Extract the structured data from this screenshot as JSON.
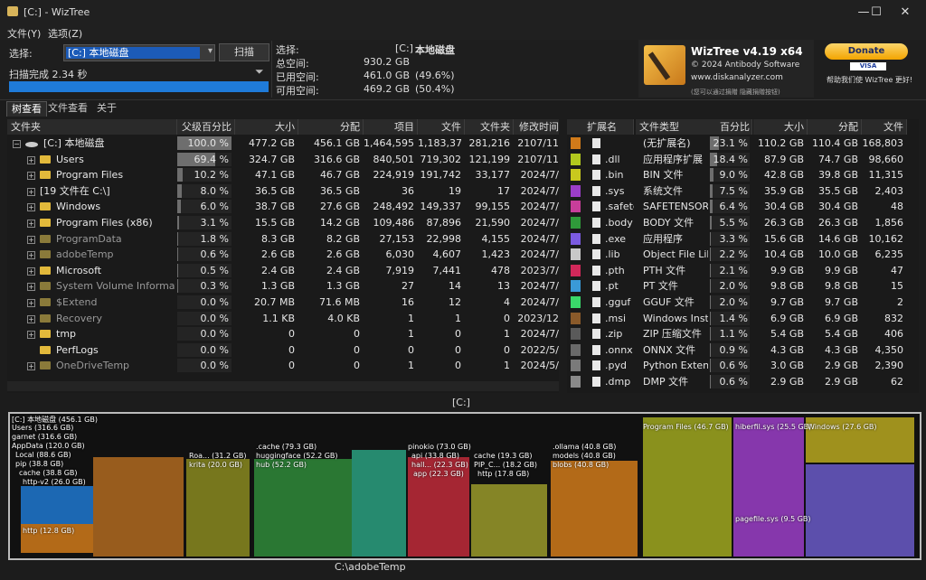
{
  "window": {
    "title": "[C:]  - WizTree"
  },
  "menu": [
    "文件(Y)",
    "选项(Z)"
  ],
  "select": {
    "label": "选择:",
    "drive": "[C:] 本地磁盘",
    "scan_button": "扫描"
  },
  "scan_status": "扫描完成 2.34 秒",
  "drive_info": {
    "select_label": "选择:",
    "drive": "[C:]",
    "drive_name": "本地磁盘",
    "rows": [
      {
        "label": "总空间:",
        "value": "930.2 GB",
        "pct": ""
      },
      {
        "label": "已用空间:",
        "value": "461.0 GB",
        "pct": "(49.6%)"
      },
      {
        "label": "可用空间:",
        "value": "469.2 GB",
        "pct": "(50.4%)"
      }
    ]
  },
  "about": {
    "title": "WizTree v4.19 x64",
    "copyright": "© 2024 Antibody Software",
    "site": "www.diskanalyzer.com",
    "note": "(您可以通过捐赠 隐藏捐赠按钮)"
  },
  "donate": {
    "button": "Donate",
    "cards": "VISA",
    "text": "帮助我们使 WizTree 更好!"
  },
  "tabs": [
    "树查看",
    "文件查看",
    "关于"
  ],
  "tree_columns": [
    "文件夹",
    "父级百分比",
    "大小",
    "分配",
    "项目",
    "文件",
    "文件夹",
    "修改时间"
  ],
  "tree_rows": [
    {
      "name": "[C:] 本地磁盘",
      "pct": "100.0 %",
      "pctv": 100,
      "size": "477.2 GB",
      "alloc": "456.1 GB",
      "items": "1,464,595",
      "files": "1,183,379",
      "folders": "281,216",
      "mtime": "2107/11",
      "indent": 0,
      "expander": "−",
      "icon": "drive"
    },
    {
      "name": "Users",
      "pct": "69.4 %",
      "pctv": 69.4,
      "size": "324.7 GB",
      "alloc": "316.6 GB",
      "items": "840,501",
      "files": "719,302",
      "folders": "121,199",
      "mtime": "2107/11",
      "indent": 1,
      "expander": "+",
      "icon": "folder"
    },
    {
      "name": "Program Files",
      "pct": "10.2 %",
      "pctv": 10.2,
      "size": "47.1 GB",
      "alloc": "46.7 GB",
      "items": "224,919",
      "files": "191,742",
      "folders": "33,177",
      "mtime": "2024/7/",
      "indent": 1,
      "expander": "+",
      "icon": "folder"
    },
    {
      "name": "[19 文件在 C:\\]",
      "pct": "8.0 %",
      "pctv": 8,
      "size": "36.5 GB",
      "alloc": "36.5 GB",
      "items": "36",
      "files": "19",
      "folders": "17",
      "mtime": "2024/7/",
      "indent": 1,
      "expander": "+",
      "icon": "none"
    },
    {
      "name": "Windows",
      "pct": "6.0 %",
      "pctv": 6,
      "size": "38.7 GB",
      "alloc": "27.6 GB",
      "items": "248,492",
      "files": "149,337",
      "folders": "99,155",
      "mtime": "2024/7/",
      "indent": 1,
      "expander": "+",
      "icon": "folder"
    },
    {
      "name": "Program Files (x86)",
      "pct": "3.1 %",
      "pctv": 3.1,
      "size": "15.5 GB",
      "alloc": "14.2 GB",
      "items": "109,486",
      "files": "87,896",
      "folders": "21,590",
      "mtime": "2024/7/",
      "indent": 1,
      "expander": "+",
      "icon": "folder"
    },
    {
      "name": "ProgramData",
      "pct": "1.8 %",
      "pctv": 1.8,
      "size": "8.3 GB",
      "alloc": "8.2 GB",
      "items": "27,153",
      "files": "22,998",
      "folders": "4,155",
      "mtime": "2024/7/",
      "indent": 1,
      "expander": "+",
      "icon": "gray"
    },
    {
      "name": "adobeTemp",
      "pct": "0.6 %",
      "pctv": 0.6,
      "size": "2.6 GB",
      "alloc": "2.6 GB",
      "items": "6,030",
      "files": "4,607",
      "folders": "1,423",
      "mtime": "2024/7/",
      "indent": 1,
      "expander": "+",
      "icon": "gray"
    },
    {
      "name": "Microsoft",
      "pct": "0.5 %",
      "pctv": 0.5,
      "size": "2.4 GB",
      "alloc": "2.4 GB",
      "items": "7,919",
      "files": "7,441",
      "folders": "478",
      "mtime": "2023/7/",
      "indent": 1,
      "expander": "+",
      "icon": "folder"
    },
    {
      "name": "System Volume Information",
      "pct": "0.3 %",
      "pctv": 0.3,
      "size": "1.3 GB",
      "alloc": "1.3 GB",
      "items": "27",
      "files": "14",
      "folders": "13",
      "mtime": "2024/7/",
      "indent": 1,
      "expander": "+",
      "icon": "sys"
    },
    {
      "name": "$Extend",
      "pct": "0.0 %",
      "pctv": 0,
      "size": "20.7 MB",
      "alloc": "71.6 MB",
      "items": "16",
      "files": "12",
      "folders": "4",
      "mtime": "2024/7/",
      "indent": 1,
      "expander": "+",
      "icon": "sys"
    },
    {
      "name": "Recovery",
      "pct": "0.0 %",
      "pctv": 0,
      "size": "1.1 KB",
      "alloc": "4.0 KB",
      "items": "1",
      "files": "1",
      "folders": "0",
      "mtime": "2023/12",
      "indent": 1,
      "expander": "+",
      "icon": "gray"
    },
    {
      "name": "tmp",
      "pct": "0.0 %",
      "pctv": 0,
      "size": "0",
      "alloc": "0",
      "items": "1",
      "files": "0",
      "folders": "1",
      "mtime": "2024/7/",
      "indent": 1,
      "expander": "+",
      "icon": "folder"
    },
    {
      "name": "PerfLogs",
      "pct": "0.0 %",
      "pctv": 0,
      "size": "0",
      "alloc": "0",
      "items": "0",
      "files": "0",
      "folders": "0",
      "mtime": "2022/5/",
      "indent": 1,
      "expander": "",
      "icon": "folder"
    },
    {
      "name": "OneDriveTemp",
      "pct": "0.0 %",
      "pctv": 0,
      "size": "0",
      "alloc": "0",
      "items": "1",
      "files": "0",
      "folders": "1",
      "mtime": "2024/5/",
      "indent": 1,
      "expander": "+",
      "icon": "gray"
    }
  ],
  "ext_columns": [
    "扩展名",
    "文件类型",
    "百分比",
    "大小",
    "分配",
    "文件"
  ],
  "ext_rows": [
    {
      "color": "#d07a1a",
      "ext": "",
      "type": "(无扩展名)",
      "pct": "23.1 %",
      "pctv": 23.1,
      "size": "110.2 GB",
      "alloc": "110.4 GB",
      "files": "168,803"
    },
    {
      "color": "#b2c81e",
      "ext": ".dll",
      "type": "应用程序扩展",
      "pct": "18.4 %",
      "pctv": 18.4,
      "size": "87.9 GB",
      "alloc": "74.7 GB",
      "files": "98,660"
    },
    {
      "color": "#c8c81e",
      "ext": ".bin",
      "type": "BIN 文件",
      "pct": "9.0 %",
      "pctv": 9,
      "size": "42.8 GB",
      "alloc": "39.8 GB",
      "files": "11,315"
    },
    {
      "color": "#9b3ec8",
      "ext": ".sys",
      "type": "系统文件",
      "pct": "7.5 %",
      "pctv": 7.5,
      "size": "35.9 GB",
      "alloc": "35.5 GB",
      "files": "2,403"
    },
    {
      "color": "#c83e9a",
      "ext": ".safetensors",
      "type": "SAFETENSORS 文件",
      "pct": "6.4 %",
      "pctv": 6.4,
      "size": "30.4 GB",
      "alloc": "30.4 GB",
      "files": "48"
    },
    {
      "color": "#2f9a3a",
      "ext": ".body",
      "type": "BODY 文件",
      "pct": "5.5 %",
      "pctv": 5.5,
      "size": "26.3 GB",
      "alloc": "26.3 GB",
      "files": "1,856"
    },
    {
      "color": "#7b5be0",
      "ext": ".exe",
      "type": "应用程序",
      "pct": "3.3 %",
      "pctv": 3.3,
      "size": "15.6 GB",
      "alloc": "14.6 GB",
      "files": "10,162"
    },
    {
      "color": "#c8c8c8",
      "ext": ".lib",
      "type": "Object File Library",
      "pct": "2.2 %",
      "pctv": 2.2,
      "size": "10.4 GB",
      "alloc": "10.0 GB",
      "files": "6,235"
    },
    {
      "color": "#d2285a",
      "ext": ".pth",
      "type": "PTH 文件",
      "pct": "2.1 %",
      "pctv": 2.1,
      "size": "9.9 GB",
      "alloc": "9.9 GB",
      "files": "47"
    },
    {
      "color": "#3a9ad8",
      "ext": ".pt",
      "type": "PT 文件",
      "pct": "2.0 %",
      "pctv": 2,
      "size": "9.8 GB",
      "alloc": "9.8 GB",
      "files": "15"
    },
    {
      "color": "#3ad86a",
      "ext": ".gguf",
      "type": "GGUF 文件",
      "pct": "2.0 %",
      "pctv": 2,
      "size": "9.7 GB",
      "alloc": "9.7 GB",
      "files": "2"
    },
    {
      "color": "#8a5a2a",
      "ext": ".msi",
      "type": "Windows Installer",
      "pct": "1.4 %",
      "pctv": 1.4,
      "size": "6.9 GB",
      "alloc": "6.9 GB",
      "files": "832"
    },
    {
      "color": "#5a5a5a",
      "ext": ".zip",
      "type": "ZIP 压缩文件",
      "pct": "1.1 %",
      "pctv": 1.1,
      "size": "5.4 GB",
      "alloc": "5.4 GB",
      "files": "406"
    },
    {
      "color": "#6a6a6a",
      "ext": ".onnx",
      "type": "ONNX 文件",
      "pct": "0.9 %",
      "pctv": 0.9,
      "size": "4.3 GB",
      "alloc": "4.3 GB",
      "files": "4,350"
    },
    {
      "color": "#7a7a7a",
      "ext": ".pyd",
      "type": "Python Extension",
      "pct": "0.6 %",
      "pctv": 0.6,
      "size": "3.0 GB",
      "alloc": "2.9 GB",
      "files": "2,390"
    },
    {
      "color": "#8a8a8a",
      "ext": ".dmp",
      "type": "DMP 文件",
      "pct": "0.6 %",
      "pctv": 0.6,
      "size": "2.9 GB",
      "alloc": "2.9 GB",
      "files": "62"
    }
  ],
  "treemap": {
    "root_label": "[C:]",
    "status_path": "C:\\adobeTemp",
    "labels": [
      "[C:] 本地磁盘 (456.1 GB)",
      "Users (316.6 GB)",
      "garnet (316.6 GB)",
      "AppData (120.0 GB)",
      "Local (88.6 GB)",
      "pip (38.8 GB)",
      "cache (38.8 GB)",
      "http-v2 (26.0 GB)",
      "http (12.8 GB)",
      "Roa... (31.2 GB)",
      "krita (20.0 GB)",
      ".cache (79.3 GB)",
      "huggingface (52.2 GB)",
      "hub (52.2 GB)",
      "pinokio (73.0 GB)",
      "api (33.8 GB)",
      "hall... (22.3 GB)",
      "app (22.3 GB)",
      "cache (19.3 GB)",
      "PIP_C... (18.2 GB)",
      "http (17.8 GB)",
      ".ollama (40.8 GB)",
      "models (40.8 GB)",
      "blobs (40.8 GB)",
      "Program Files (46.7 GB)",
      "hiberfil.sys (25.5 GB)",
      "pagefile.sys (9.5 GB)",
      "Windows (27.6 GB)"
    ]
  }
}
